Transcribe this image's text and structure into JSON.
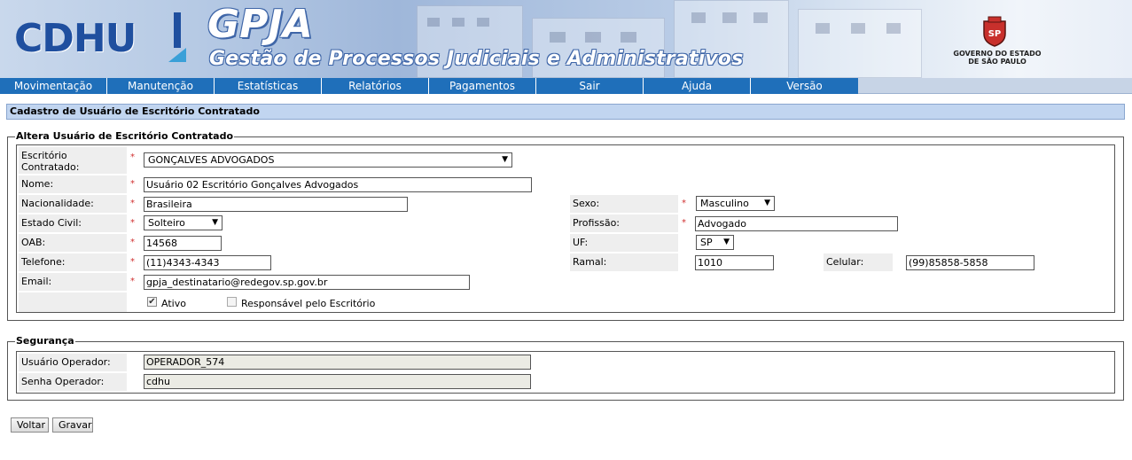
{
  "banner": {
    "logo": "CDHU",
    "app_title": "GPJA",
    "app_subtitle": "Gestão de Processos Judiciais e Administrativos",
    "gov_line1": "GOVERNO DO ESTADO",
    "gov_line2": "DE SÃO PAULO",
    "gov_seal_text": "SP"
  },
  "menu": {
    "items": [
      "Movimentação",
      "Manutenção",
      "Estatísticas",
      "Relatórios",
      "Pagamentos",
      "Sair",
      "Ajuda",
      "Versão"
    ]
  },
  "page": {
    "title": "Cadastro de Usuário de Escritório Contratado"
  },
  "user_section": {
    "legend": "Altera Usuário de Escritório Contratado",
    "required_mark": "*",
    "fields": {
      "escritorio": {
        "label": "Escritório Contratado:",
        "value": "GONÇALVES ADVOGADOS"
      },
      "nome": {
        "label": "Nome:",
        "value": "Usuário 02 Escritório Gonçalves Advogados"
      },
      "nacionalidade": {
        "label": "Nacionalidade:",
        "value": "Brasileira"
      },
      "sexo": {
        "label": "Sexo:",
        "value": "Masculino"
      },
      "estado_civil": {
        "label": "Estado Civil:",
        "value": "Solteiro"
      },
      "profissao": {
        "label": "Profissão:",
        "value": "Advogado"
      },
      "oab": {
        "label": "OAB:",
        "value": "14568"
      },
      "uf": {
        "label": "UF:",
        "value": "SP"
      },
      "telefone": {
        "label": "Telefone:",
        "value": "(11)4343-4343"
      },
      "ramal": {
        "label": "Ramal:",
        "value": "1010"
      },
      "celular": {
        "label": "Celular:",
        "value": "(99)85858-5858"
      },
      "email": {
        "label": "Email:",
        "value": "gpja_destinatario@redegov.sp.gov.br"
      }
    },
    "checkboxes": {
      "ativo": {
        "label": "Ativo",
        "checked": true
      },
      "responsavel": {
        "label": "Responsável pelo Escritório",
        "checked": false
      }
    }
  },
  "security_section": {
    "legend": "Segurança",
    "fields": {
      "usuario_operador": {
        "label": "Usuário Operador:",
        "value": "OPERADOR_574"
      },
      "senha_operador": {
        "label": "Senha Operador:",
        "value": "cdhu"
      }
    }
  },
  "buttons": {
    "voltar": "Voltar",
    "gravar": "Gravar"
  },
  "icons": {
    "dropdown": "▼",
    "check": "✔"
  },
  "colors": {
    "menu_bg": "#1f6fba",
    "header_bg": "#c1d5f0",
    "required": "#d03030"
  }
}
